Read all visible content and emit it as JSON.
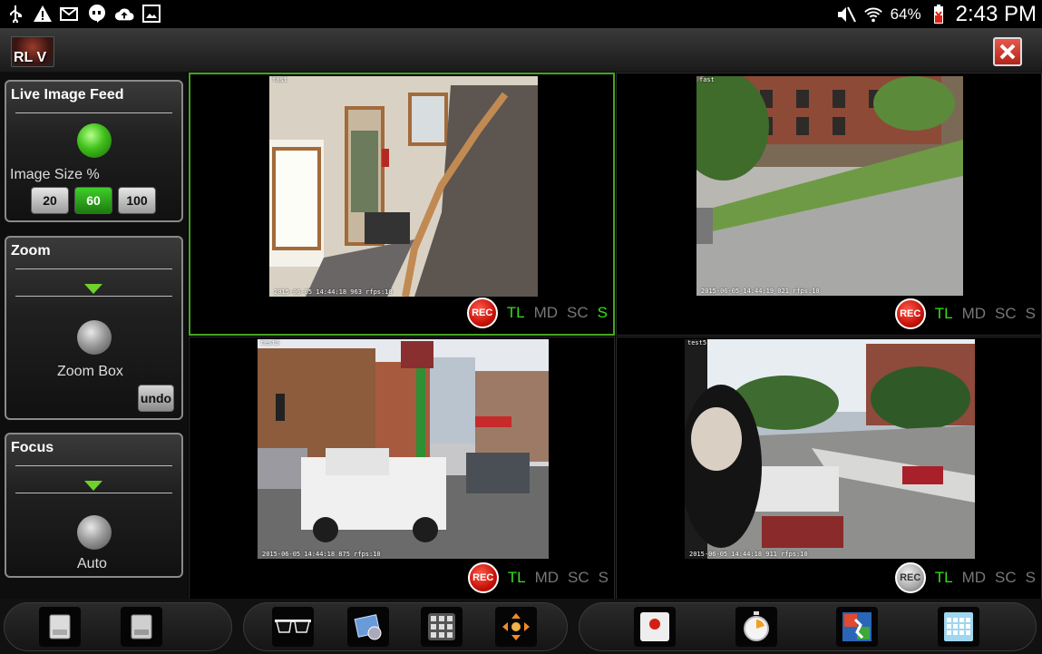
{
  "statusbar": {
    "left_icons": [
      "usb-icon",
      "warning-icon",
      "mail-icon",
      "hangouts-icon",
      "cloud-upload-icon",
      "gallery-icon"
    ],
    "right_icons": [
      "mute-icon",
      "wifi-icon",
      "battery-icon"
    ],
    "battery": "64%",
    "time": "2:43 PM"
  },
  "app": {
    "logo_text": "RL V",
    "close_icon": "close-icon"
  },
  "live_feed": {
    "title": "Live Image Feed",
    "image_size_label": "Image Size %",
    "sizes": [
      "20",
      "60",
      "100"
    ],
    "selected_size": "60",
    "status_color": "#3fbf1a"
  },
  "zoom": {
    "title": "Zoom",
    "zoom_box_label": "Zoom Box",
    "undo_label": "undo"
  },
  "focus": {
    "title": "Focus",
    "auto_label": "Auto"
  },
  "cameras": [
    {
      "name": "fast",
      "timestamp": "2015-06-05 14:44:18 963  rfps:10",
      "rec": "REC",
      "rec_state": "on",
      "modes": [
        {
          "label": "TL",
          "on": true
        },
        {
          "label": "MD",
          "on": false
        },
        {
          "label": "SC",
          "on": false
        },
        {
          "label": "S",
          "on": true
        }
      ]
    },
    {
      "name": "fast",
      "timestamp": "2015-06-05 14:44:19 021  rfps:10",
      "rec": "REC",
      "rec_state": "on",
      "modes": [
        {
          "label": "TL",
          "on": true
        },
        {
          "label": "MD",
          "on": false
        },
        {
          "label": "SC",
          "on": false
        },
        {
          "label": "S",
          "on": false
        }
      ]
    },
    {
      "name": "test5",
      "timestamp": "2015-06-05 14:44:18 875  rfps:10",
      "rec": "REC",
      "rec_state": "on",
      "modes": [
        {
          "label": "TL",
          "on": true
        },
        {
          "label": "MD",
          "on": false
        },
        {
          "label": "SC",
          "on": false
        },
        {
          "label": "S",
          "on": false
        }
      ]
    },
    {
      "name": "test5",
      "timestamp": "2015-06-05 14:44:18 911  rfps:10",
      "rec": "REC",
      "rec_state": "off",
      "modes": [
        {
          "label": "TL",
          "on": true
        },
        {
          "label": "MD",
          "on": false
        },
        {
          "label": "SC",
          "on": false
        },
        {
          "label": "S",
          "on": false
        }
      ]
    }
  ],
  "toolbar": {
    "icons": [
      "drive-icon",
      "drive-alt-icon",
      "glasses-icon",
      "photo-settings-icon",
      "grid-icon",
      "move-arrows-icon",
      "record-icon",
      "timer-icon",
      "motion-detect-icon",
      "calendar-icon"
    ],
    "rec_icon_text": "REC"
  }
}
